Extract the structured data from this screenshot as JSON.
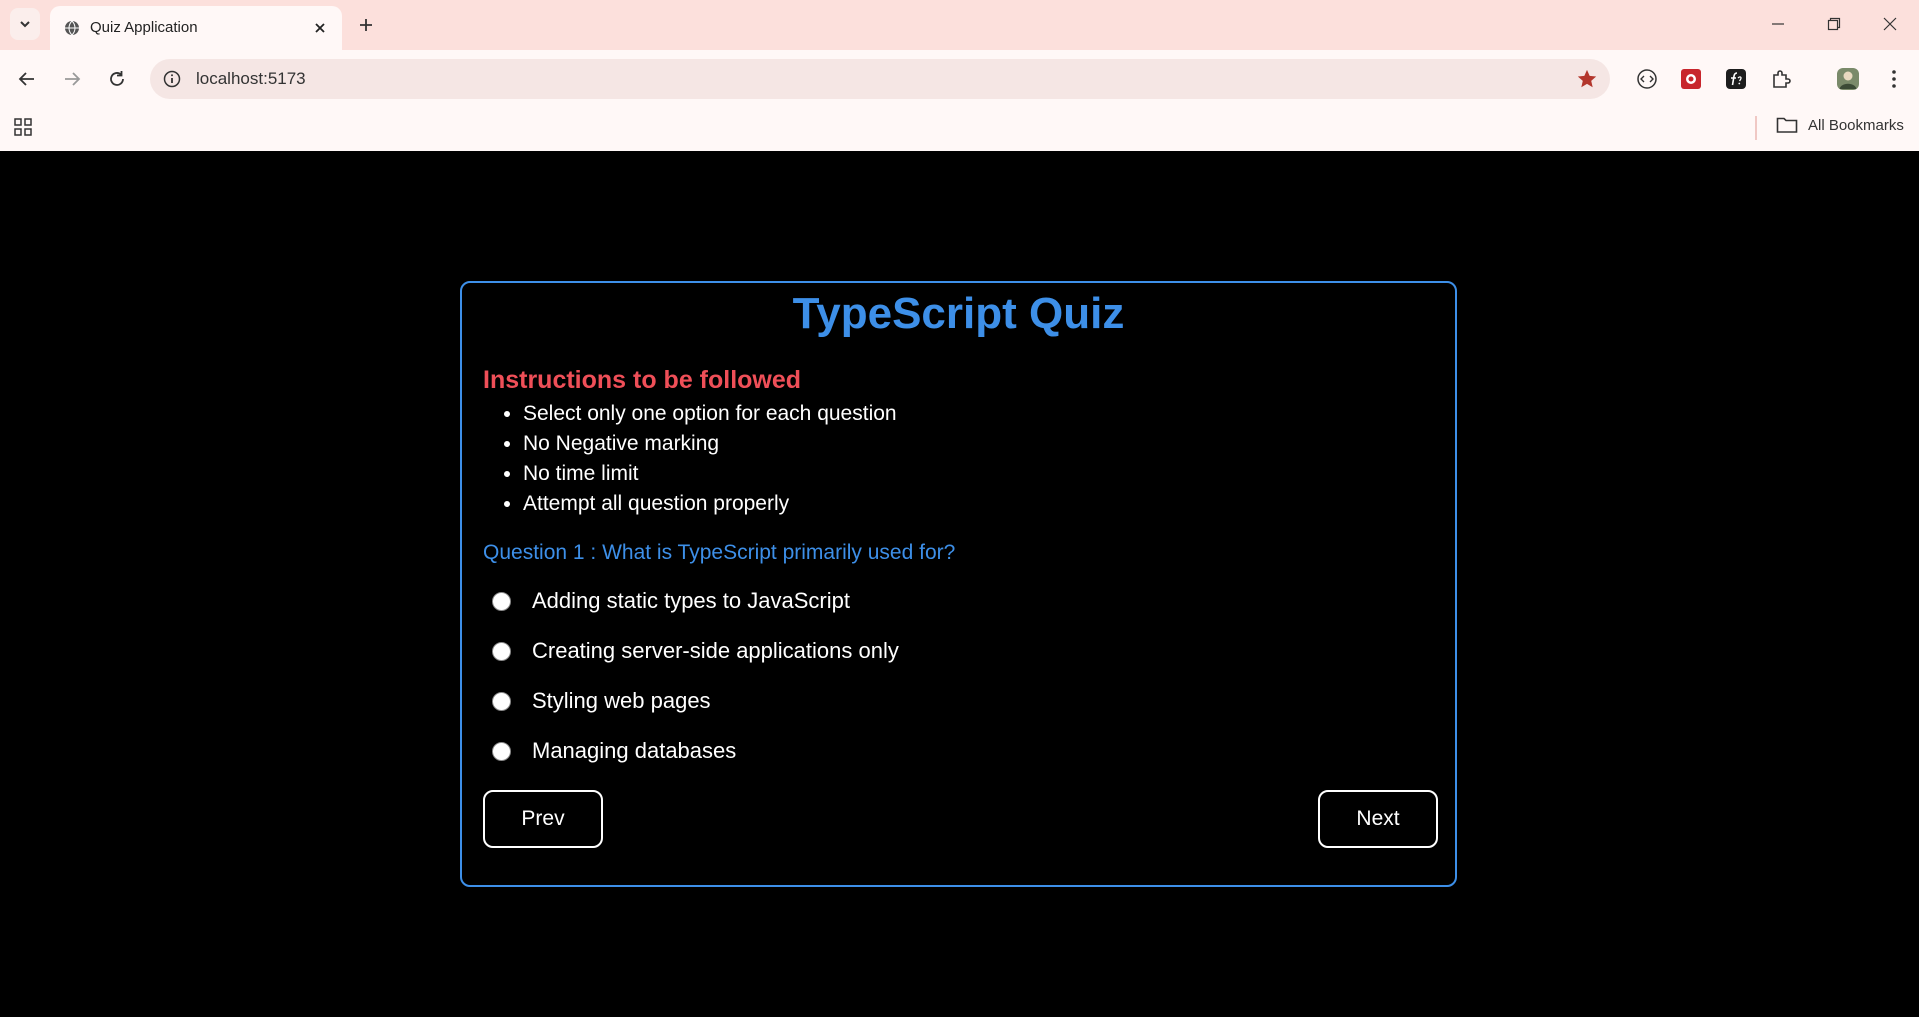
{
  "browser": {
    "tab_title": "Quiz Application",
    "url": "localhost:5173",
    "bookmarks_label": "All Bookmarks"
  },
  "quiz": {
    "title": "TypeScript Quiz",
    "instructions_heading": "Instructions to be followed",
    "instructions": [
      "Select only one option for each question",
      "No Negative marking",
      "No time limit",
      "Attempt all question properly"
    ],
    "question": "Question 1 : What is TypeScript primarily used for?",
    "options": [
      "Adding static types to JavaScript",
      "Creating server-side applications only",
      "Styling web pages",
      "Managing databases"
    ],
    "prev_label": "Prev",
    "next_label": "Next"
  },
  "colors": {
    "accent": "#3d8fe8",
    "heading_red": "#ef4f58",
    "background": "#000000"
  }
}
